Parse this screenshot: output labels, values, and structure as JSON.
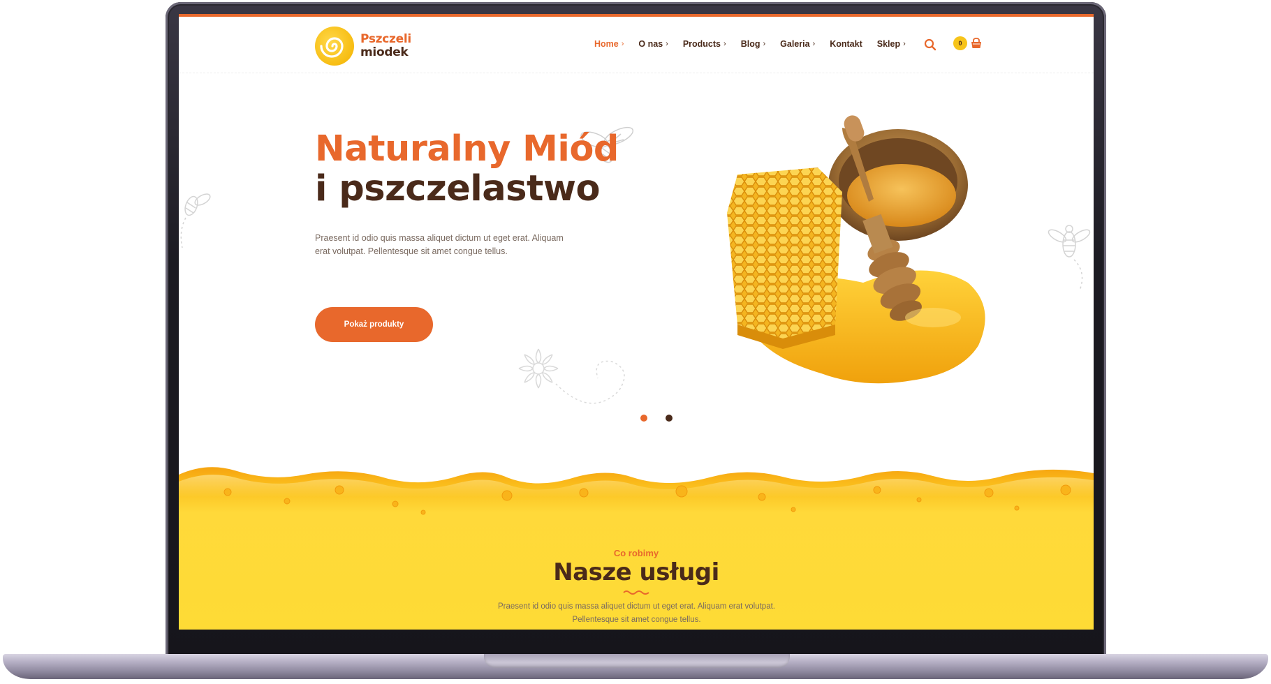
{
  "brand": {
    "line1": "Pszczeli",
    "line2": "miodek"
  },
  "nav": {
    "items": [
      {
        "label": "Home",
        "chevron": "›"
      },
      {
        "label": "O nas",
        "chevron": "›"
      },
      {
        "label": "Products",
        "chevron": "›"
      },
      {
        "label": "Blog",
        "chevron": "›"
      },
      {
        "label": "Galeria",
        "chevron": "›"
      },
      {
        "label": "Kontakt",
        "chevron": ""
      },
      {
        "label": "Sklep",
        "chevron": "›"
      }
    ],
    "active_item": "Home",
    "cart_count": "0"
  },
  "hero": {
    "title_line1": "Naturalny Miód",
    "title_line2": "i pszczelastwo",
    "text": "Praesent id odio quis massa aliquet dictum ut eget erat. Aliquam erat volutpat. Pellentesque sit amet congue tellus.",
    "button_label": "Pokaż produkty",
    "slides_total": 2,
    "active_slide": 1
  },
  "services": {
    "kicker": "Co robimy",
    "title": "Nasze usługi",
    "text": "Praesent id odio quis massa aliquet dictum ut eget erat. Aliquam erat volutpat. Pellentesque sit amet congue tellus."
  },
  "colors": {
    "accent_orange": "#e8682c",
    "dark_brown": "#4a2a1a",
    "honey_yellow": "#fdd835",
    "honey_amber": "#f7b81a",
    "laptop_frame": "#1c1b22"
  },
  "icons": [
    "bee-logo-icon",
    "chevron-right-icon",
    "search-icon",
    "shopping-bag-icon",
    "bee-illustration-icon",
    "flower-illustration-icon"
  ]
}
